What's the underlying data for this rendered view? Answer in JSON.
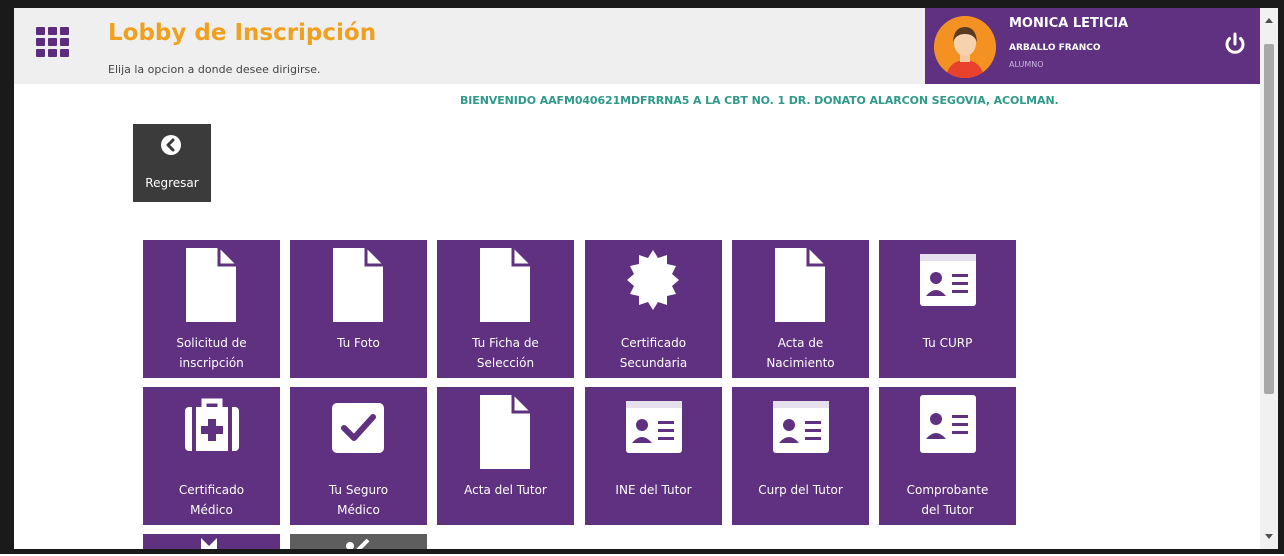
{
  "header": {
    "title": "Lobby de Inscripción",
    "subtitle": "Elija la opcion a donde desee dirigirse.",
    "menu_icon": "grid-menu-icon"
  },
  "user": {
    "name": "MONICA LETICIA",
    "last_name": "ARBALLO FRANCO",
    "role": "ALUMNO",
    "power_icon": "power-icon"
  },
  "welcome": "BIENVENIDO AAFM040621MDFRRNA5 A LA CBT NO. 1 DR. DONATO ALARCON SEGOVIA, ACOLMAN.",
  "back_button": {
    "label": "Regresar",
    "icon": "chevron-left-icon"
  },
  "tiles": [
    {
      "line1": "Solicitud de",
      "line2": "inscripción",
      "icon": "document-icon"
    },
    {
      "line1": "Tu Foto",
      "line2": "",
      "icon": "document-icon"
    },
    {
      "line1": "Tu Ficha de",
      "line2": "Selección",
      "icon": "document-icon"
    },
    {
      "line1": "Certificado",
      "line2": "Secundaria",
      "icon": "certificate-seal-icon"
    },
    {
      "line1": "Acta de",
      "line2": "Nacimiento",
      "icon": "document-icon"
    },
    {
      "line1": "Tu CURP",
      "line2": "",
      "icon": "id-card-icon"
    },
    {
      "line1": "Certificado",
      "line2": "Médico",
      "icon": "medical-kit-icon"
    },
    {
      "line1": "Tu Seguro",
      "line2": "Médico",
      "icon": "checkbox-icon"
    },
    {
      "line1": "Acta del Tutor",
      "line2": "",
      "icon": "document-icon"
    },
    {
      "line1": "INE del Tutor",
      "line2": "",
      "icon": "id-card-icon"
    },
    {
      "line1": "Curp del Tutor",
      "line2": "",
      "icon": "id-card-icon"
    },
    {
      "line1": "Comprobante",
      "line2": "del Tutor",
      "icon": "id-card-icon"
    }
  ],
  "colors": {
    "tile_bg": "#603081",
    "title": "#f0a020",
    "welcome": "#2f9a8a",
    "back_bg": "#3b3b3b"
  }
}
